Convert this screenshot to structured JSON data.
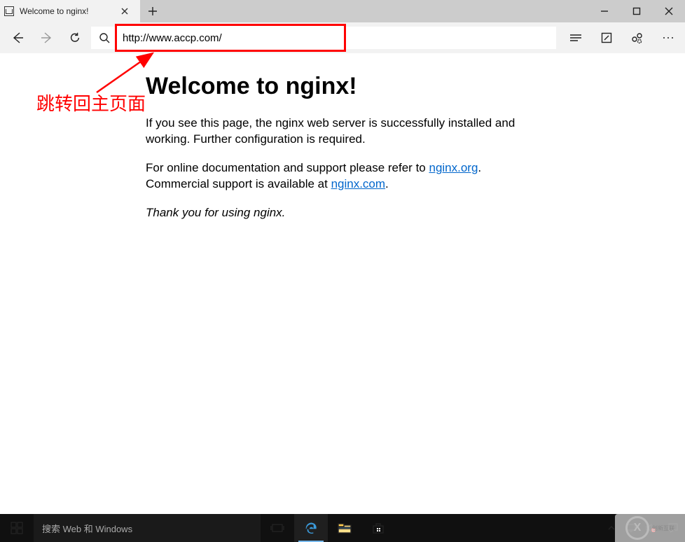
{
  "browser": {
    "tab_title": "Welcome to nginx!",
    "address": "http://www.accp.com/"
  },
  "annotation": {
    "text": "跳转回主页面"
  },
  "page": {
    "heading": "Welcome to nginx!",
    "p1": "If you see this page, the nginx web server is successfully installed and working. Further configuration is required.",
    "p2a": "For online documentation and support please refer to ",
    "link1": "nginx.org",
    "p2b": ".",
    "p3a": "Commercial support is available at ",
    "link2": "nginx.com",
    "p3b": ".",
    "thanks": "Thank you for using nginx."
  },
  "taskbar": {
    "search_placeholder": "搜索 Web 和 Windows"
  },
  "watermark": {
    "logo_letter": "X",
    "text": "创新互联"
  }
}
